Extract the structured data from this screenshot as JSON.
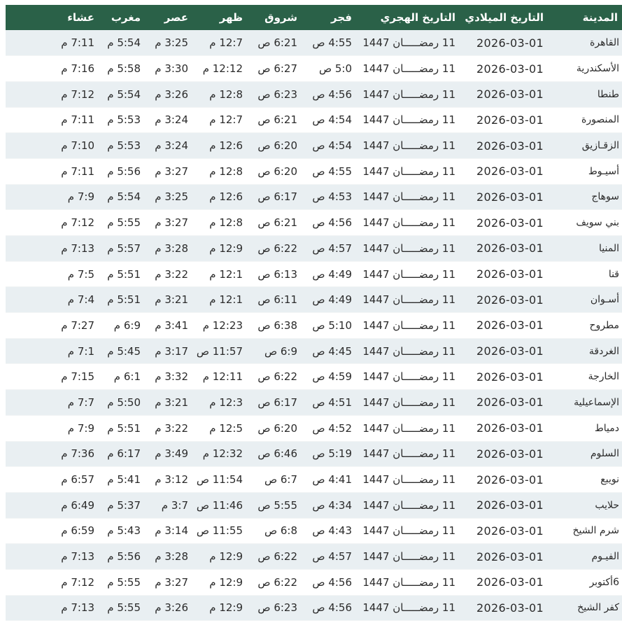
{
  "table": {
    "headers": [
      "المدينة",
      "التاريخ الميلادي",
      "التاريخ الهجري",
      "فجر",
      "شروق",
      "ظهر",
      "عصر",
      "مغرب",
      "عشاء"
    ],
    "rows": [
      {
        "city": "القاهرة",
        "greg": "2026-03-01",
        "hijri": "11 رمضـــــان 1447",
        "fajr": "4:55 ص",
        "shuruq": "6:21 ص",
        "dhuhr": "12:7 م",
        "asr": "3:25 م",
        "maghrib": "5:54 م",
        "isha": "7:11 م"
      },
      {
        "city": "الأسكندرية",
        "greg": "2026-03-01",
        "hijri": "11 رمضـــــان 1447",
        "fajr": "5:0 ص",
        "shuruq": "6:27 ص",
        "dhuhr": "12:12 م",
        "asr": "3:30 م",
        "maghrib": "5:58 م",
        "isha": "7:16 م"
      },
      {
        "city": "طنطا",
        "greg": "2026-03-01",
        "hijri": "11 رمضـــــان 1447",
        "fajr": "4:56 ص",
        "shuruq": "6:23 ص",
        "dhuhr": "12:8 م",
        "asr": "3:26 م",
        "maghrib": "5:54 م",
        "isha": "7:12 م"
      },
      {
        "city": "المنصورة",
        "greg": "2026-03-01",
        "hijri": "11 رمضـــــان 1447",
        "fajr": "4:54 ص",
        "shuruq": "6:21 ص",
        "dhuhr": "12:7 م",
        "asr": "3:24 م",
        "maghrib": "5:53 م",
        "isha": "7:11 م"
      },
      {
        "city": "الزقـازيق",
        "greg": "2026-03-01",
        "hijri": "11 رمضـــــان 1447",
        "fajr": "4:54 ص",
        "shuruq": "6:20 ص",
        "dhuhr": "12:6 م",
        "asr": "3:24 م",
        "maghrib": "5:53 م",
        "isha": "7:10 م"
      },
      {
        "city": "أسيـوط",
        "greg": "2026-03-01",
        "hijri": "11 رمضـــــان 1447",
        "fajr": "4:55 ص",
        "shuruq": "6:20 ص",
        "dhuhr": "12:8 م",
        "asr": "3:27 م",
        "maghrib": "5:56 م",
        "isha": "7:11 م"
      },
      {
        "city": "سوهاج",
        "greg": "2026-03-01",
        "hijri": "11 رمضـــــان 1447",
        "fajr": "4:53 ص",
        "shuruq": "6:17 ص",
        "dhuhr": "12:6 م",
        "asr": "3:25 م",
        "maghrib": "5:54 م",
        "isha": "7:9 م"
      },
      {
        "city": "بني سويف",
        "greg": "2026-03-01",
        "hijri": "11 رمضـــــان 1447",
        "fajr": "4:56 ص",
        "shuruq": "6:21 ص",
        "dhuhr": "12:8 م",
        "asr": "3:27 م",
        "maghrib": "5:55 م",
        "isha": "7:12 م"
      },
      {
        "city": "المنيا",
        "greg": "2026-03-01",
        "hijri": "11 رمضـــــان 1447",
        "fajr": "4:57 ص",
        "shuruq": "6:22 ص",
        "dhuhr": "12:9 م",
        "asr": "3:28 م",
        "maghrib": "5:57 م",
        "isha": "7:13 م"
      },
      {
        "city": "قنا",
        "greg": "2026-03-01",
        "hijri": "11 رمضـــــان 1447",
        "fajr": "4:49 ص",
        "shuruq": "6:13 ص",
        "dhuhr": "12:1 م",
        "asr": "3:22 م",
        "maghrib": "5:51 م",
        "isha": "7:5 م"
      },
      {
        "city": "أسـوان",
        "greg": "2026-03-01",
        "hijri": "11 رمضـــــان 1447",
        "fajr": "4:49 ص",
        "shuruq": "6:11 ص",
        "dhuhr": "12:1 م",
        "asr": "3:21 م",
        "maghrib": "5:51 م",
        "isha": "7:4 م"
      },
      {
        "city": "مطروح",
        "greg": "2026-03-01",
        "hijri": "11 رمضـــــان 1447",
        "fajr": "5:10 ص",
        "shuruq": "6:38 ص",
        "dhuhr": "12:23 م",
        "asr": "3:41 م",
        "maghrib": "6:9 م",
        "isha": "7:27 م"
      },
      {
        "city": "الغردقة",
        "greg": "2026-03-01",
        "hijri": "11 رمضـــــان 1447",
        "fajr": "4:45 ص",
        "shuruq": "6:9 ص",
        "dhuhr": "11:57 ص",
        "asr": "3:17 م",
        "maghrib": "5:45 م",
        "isha": "7:1 م"
      },
      {
        "city": "الخارجة",
        "greg": "2026-03-01",
        "hijri": "11 رمضـــــان 1447",
        "fajr": "4:59 ص",
        "shuruq": "6:22 ص",
        "dhuhr": "12:11 م",
        "asr": "3:32 م",
        "maghrib": "6:1 م",
        "isha": "7:15 م"
      },
      {
        "city": "الإسماعيلية",
        "greg": "2026-03-01",
        "hijri": "11 رمضـــــان 1447",
        "fajr": "4:51 ص",
        "shuruq": "6:17 ص",
        "dhuhr": "12:3 م",
        "asr": "3:21 م",
        "maghrib": "5:50 م",
        "isha": "7:7 م"
      },
      {
        "city": "دمياط",
        "greg": "2026-03-01",
        "hijri": "11 رمضـــــان 1447",
        "fajr": "4:52 ص",
        "shuruq": "6:20 ص",
        "dhuhr": "12:5 م",
        "asr": "3:22 م",
        "maghrib": "5:51 م",
        "isha": "7:9 م"
      },
      {
        "city": "السلوم",
        "greg": "2026-03-01",
        "hijri": "11 رمضـــــان 1447",
        "fajr": "5:19 ص",
        "shuruq": "6:46 ص",
        "dhuhr": "12:32 م",
        "asr": "3:49 م",
        "maghrib": "6:17 م",
        "isha": "7:36 م"
      },
      {
        "city": "نويبع",
        "greg": "2026-03-01",
        "hijri": "11 رمضـــــان 1447",
        "fajr": "4:41 ص",
        "shuruq": "6:7 ص",
        "dhuhr": "11:54 ص",
        "asr": "3:12 م",
        "maghrib": "5:41 م",
        "isha": "6:57 م"
      },
      {
        "city": "حلايب",
        "greg": "2026-03-01",
        "hijri": "11 رمضـــــان 1447",
        "fajr": "4:34 ص",
        "shuruq": "5:55 ص",
        "dhuhr": "11:46 ص",
        "asr": "3:7 م",
        "maghrib": "5:37 م",
        "isha": "6:49 م"
      },
      {
        "city": "شرم الشيخ",
        "greg": "2026-03-01",
        "hijri": "11 رمضـــــان 1447",
        "fajr": "4:43 ص",
        "shuruq": "6:8 ص",
        "dhuhr": "11:55 ص",
        "asr": "3:14 م",
        "maghrib": "5:43 م",
        "isha": "6:59 م"
      },
      {
        "city": "الفيـوم",
        "greg": "2026-03-01",
        "hijri": "11 رمضـــــان 1447",
        "fajr": "4:57 ص",
        "shuruq": "6:22 ص",
        "dhuhr": "12:9 م",
        "asr": "3:28 م",
        "maghrib": "5:56 م",
        "isha": "7:13 م"
      },
      {
        "city": "6أكتوبر",
        "greg": "2026-03-01",
        "hijri": "11 رمضـــــان 1447",
        "fajr": "4:56 ص",
        "shuruq": "6:22 ص",
        "dhuhr": "12:9 م",
        "asr": "3:27 م",
        "maghrib": "5:55 م",
        "isha": "7:12 م"
      },
      {
        "city": "كفر الشيخ",
        "greg": "2026-03-01",
        "hijri": "11 رمضـــــان 1447",
        "fajr": "4:56 ص",
        "shuruq": "6:23 ص",
        "dhuhr": "12:9 م",
        "asr": "3:26 م",
        "maghrib": "5:55 م",
        "isha": "7:13 م"
      }
    ]
  },
  "colors": {
    "header_bg": "#2a6148",
    "header_text": "#ffffff",
    "row_alt_bg": "#e9eff2",
    "row_bg": "#ffffff",
    "text": "#2b2b2b"
  }
}
